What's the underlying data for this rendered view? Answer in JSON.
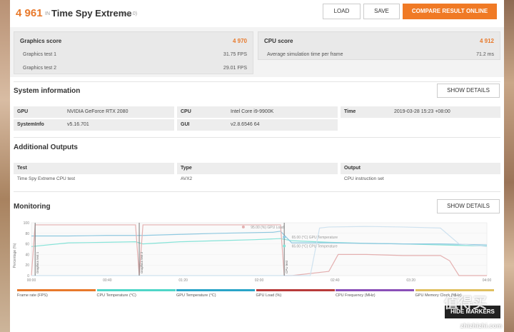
{
  "header": {
    "score": "4 961",
    "in": "IN",
    "benchmark": "Time Spy Extreme",
    "version": "(V1.0)",
    "load_label": "LOAD",
    "save_label": "SAVE",
    "compare_label": "COMPARE RESULT ONLINE"
  },
  "graphics": {
    "title": "Graphics score",
    "score": "4 970",
    "tests": [
      {
        "label": "Graphics test 1",
        "value": "31.75 FPS"
      },
      {
        "label": "Graphics test 2",
        "value": "29.01 FPS"
      }
    ]
  },
  "cpu": {
    "title": "CPU score",
    "score": "4 912",
    "row_label": "Average simulation time per frame",
    "row_value": "71.2 ms"
  },
  "system_info": {
    "title": "System information",
    "show_details": "SHOW DETAILS",
    "gpu_label": "GPU",
    "gpu_value": "NVIDIA GeForce RTX 2080",
    "cpu_label": "CPU",
    "cpu_value": "Intel Core i9-9900K",
    "time_label": "Time",
    "time_value": "2019-03-28 15:23 +08:00",
    "sysinfo_label": "SystemInfo",
    "sysinfo_value": "v5.16.701",
    "gui_label": "GUI",
    "gui_value": "v2.8.6546 64"
  },
  "additional": {
    "title": "Additional Outputs",
    "headers": [
      "Test",
      "Type",
      "Output"
    ],
    "values": [
      "Time Spy Extreme CPU test",
      "AVX2",
      "CPU instruction set"
    ]
  },
  "monitoring": {
    "title": "Monitoring",
    "show_details": "SHOW DETAILS",
    "y_axis_label": "Percentage (%)",
    "y_ticks": [
      "100",
      "80",
      "60",
      "40",
      "20",
      "0"
    ],
    "x_ticks": [
      "00:00",
      "00:40",
      "01:20",
      "02:00",
      "02:40",
      "03:20",
      "04:00"
    ],
    "markers": [
      "Graphics test 1",
      "Graphics test 2",
      "CPU test"
    ],
    "annotations": [
      "95.00 (%) GPU Load",
      "65.00 (°C) GPU Temperature",
      "65.00 (°C) CPU Temperature"
    ],
    "legend": [
      {
        "label": "Frame rate (FPS)",
        "color": "#e8792b"
      },
      {
        "label": "CPU Temperature (°C)",
        "color": "#4fd6c8"
      },
      {
        "label": "GPU Temperature (°C)",
        "color": "#2aa4c8"
      },
      {
        "label": "GPU Load (%)",
        "color": "#b83a3a"
      },
      {
        "label": "CPU Frequency (MHz)",
        "color": "#8a4fb8"
      },
      {
        "label": "GPU Memory Clock (MHz)",
        "color": "#e0c060"
      }
    ],
    "hide_markers": "HIDE MARKERS"
  },
  "chart_data": {
    "type": "line",
    "ylabel": "Percentage (%)",
    "ylim": [
      0,
      100
    ],
    "xlim": [
      0,
      245
    ],
    "x_ticks": [
      "00:00",
      "00:40",
      "01:20",
      "02:00",
      "02:40",
      "03:20",
      "04:00"
    ],
    "series": [
      {
        "name": "CPU Temperature (°C)",
        "x": [
          0,
          20,
          40,
          56,
          60,
          80,
          100,
          120,
          134,
          140,
          160,
          180,
          200,
          220,
          245
        ],
        "values": [
          55,
          62,
          63,
          64,
          60,
          64,
          66,
          68,
          70,
          66,
          63,
          61,
          60,
          58,
          56
        ]
      },
      {
        "name": "GPU Temperature (°C)",
        "x": [
          0,
          20,
          40,
          56,
          60,
          80,
          100,
          130,
          134,
          140,
          160,
          180,
          200,
          220,
          245
        ],
        "values": [
          75,
          75,
          76,
          76,
          76,
          78,
          80,
          82,
          84,
          62,
          62,
          61,
          60,
          60,
          58
        ]
      },
      {
        "name": "GPU Load (%)",
        "x": [
          0,
          2,
          56,
          58,
          60,
          134,
          136,
          140,
          160,
          165,
          180,
          200,
          220,
          225,
          230,
          245
        ],
        "values": [
          0,
          96,
          96,
          0,
          96,
          96,
          0,
          0,
          8,
          40,
          40,
          38,
          38,
          28,
          0,
          0
        ]
      },
      {
        "name": "CPU Frequency (MHz)",
        "x": [
          0,
          150,
          155,
          160,
          180,
          200,
          220,
          225,
          230,
          245
        ],
        "values": [
          0,
          0,
          90,
          92,
          93,
          92,
          90,
          75,
          60,
          55
        ]
      }
    ]
  },
  "watermark": {
    "big": "值得买",
    "url": "zhizhizhi.com"
  }
}
